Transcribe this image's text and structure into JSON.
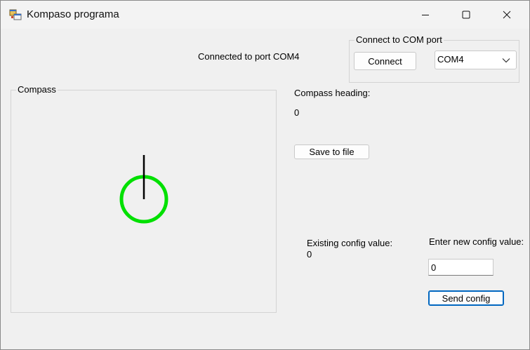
{
  "window": {
    "title": "Kompaso programa",
    "icon": "app-window-icon",
    "controls": [
      "minimize-icon",
      "maximize-icon",
      "close-icon"
    ]
  },
  "status": {
    "connected_text": "Connected to port COM4"
  },
  "com_port_group": {
    "legend": "Connect to COM port",
    "connect_label": "Connect",
    "selected_port": "COM4"
  },
  "compass_group": {
    "legend": "Compass",
    "ring_color": "#00e000",
    "needle_color": "#000000"
  },
  "heading": {
    "label": "Compass heading:",
    "value": "0",
    "save_label": "Save to file"
  },
  "config": {
    "existing_label": "Existing config value:",
    "existing_value": "0",
    "new_label": "Enter new config value:",
    "new_value": "0",
    "send_label": "Send config"
  }
}
